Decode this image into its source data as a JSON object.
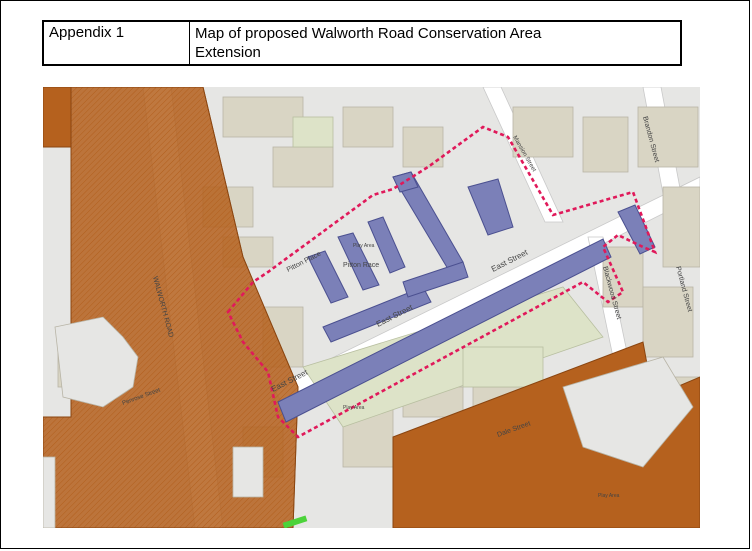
{
  "header": {
    "appendix": "Appendix 1",
    "title_line1": "Map of proposed Walworth Road Conservation Area",
    "title_line2": "Extension"
  },
  "map": {
    "colors": {
      "conservation_area": "#b5611e",
      "listed_buildings": "#7b80b8",
      "extension_boundary": "#e0195a",
      "buildings": "#d9d5c4",
      "ground": "#e6e6e4",
      "green": "#dde3c8"
    },
    "labels": {
      "walworth_road": "WALWORTH ROAD",
      "east_street_1": "East Street",
      "east_street_2": "East Street",
      "east_street_3": "East Street",
      "pitton_place": "Pitton Place",
      "pitton_race": "Pitton Race",
      "penrose": "Penrose Street",
      "brandon_street": "Brandon Street",
      "portland_street": "Portland Street",
      "blackwood_street": "Blackwood Street",
      "dale_street": "Dale Street",
      "play_area_1": "Play Area",
      "play_area_2": "Play Area",
      "play_area_3": "Play Area",
      "mansion_street": "Mansion Street"
    }
  }
}
